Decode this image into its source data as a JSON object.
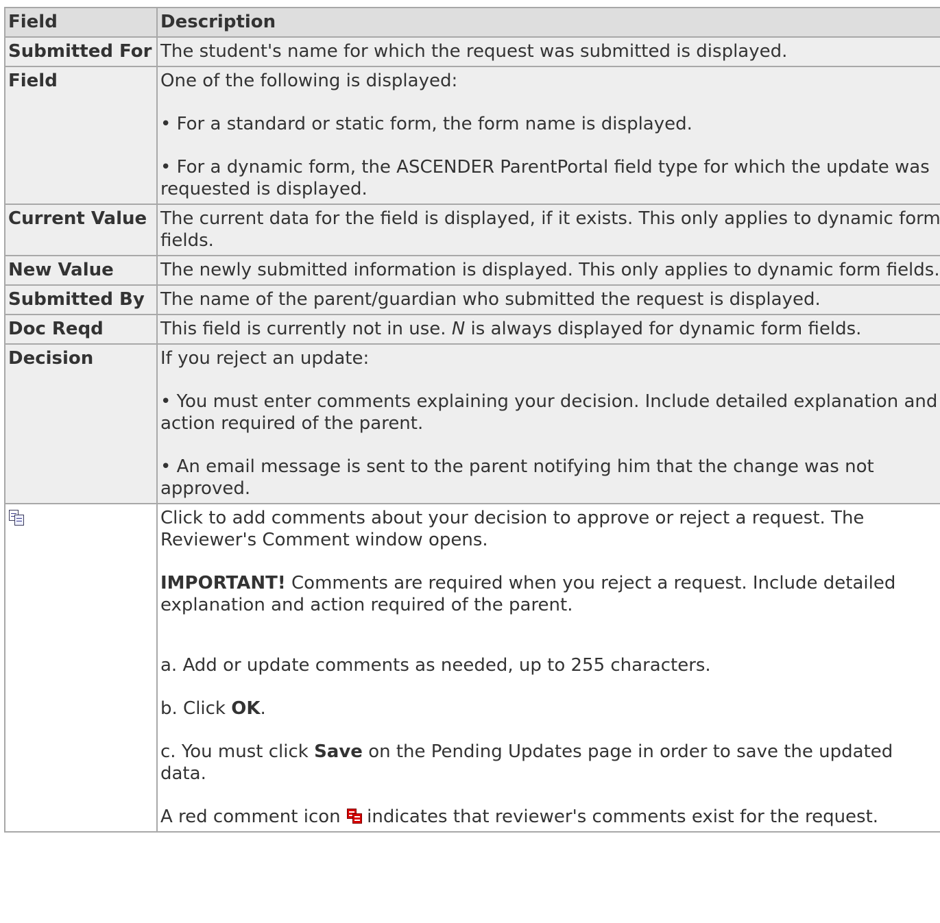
{
  "header": {
    "field": "Field",
    "description": "Description"
  },
  "rows": {
    "submitted_for": {
      "name": "Submitted For",
      "desc": "The student's name for which the request was submitted is displayed."
    },
    "field": {
      "name": "Field",
      "p1": "One of the following is displayed:",
      "p2": "• For a standard or static form, the form name is displayed.",
      "p3": "• For a dynamic form, the ASCENDER ParentPortal field type for which the update was requested is displayed."
    },
    "current_value": {
      "name": "Current Value",
      "desc": "The current data for the field is displayed, if it exists. This only applies to dynamic form fields."
    },
    "new_value": {
      "name": "New Value",
      "desc": "The newly submitted information is displayed. This only applies to dynamic form fields."
    },
    "submitted_by": {
      "name": "Submitted By",
      "desc": "The name of the parent/guardian who submitted the request is displayed."
    },
    "doc_reqd": {
      "name": "Doc Reqd",
      "desc_before": "This field is currently not in use. ",
      "desc_italic": "N",
      "desc_after": " is always displayed for dynamic form fields."
    },
    "decision": {
      "name": "Decision",
      "p1": "If you reject an update:",
      "p2": "• You must enter comments explaining your decision. Include detailed explanation and action required of the parent.",
      "p3": "• An email message is sent to the parent notifying him that the change was not approved."
    },
    "comment": {
      "icon": "comment-copy-icon",
      "p1": "Click to add comments about your decision to approve or reject a request. The Reviewer's Comment window opens.",
      "important_label": "IMPORTANT!",
      "important_text": " Comments are required when you reject a request. Include detailed explanation and action required of the parent.",
      "step_a": "a. Add or update comments as needed, up to 255 characters.",
      "step_b_before": "b. Click ",
      "step_b_bold": "OK",
      "step_b_after": ".",
      "step_c_before": "c. You must click ",
      "step_c_bold": "Save",
      "step_c_after": " on the Pending Updates page in order to save the updated data.",
      "red_before": "A red comment icon ",
      "red_icon": "red-comment-icon",
      "red_after": " indicates that reviewer's comments exist for the request."
    }
  }
}
